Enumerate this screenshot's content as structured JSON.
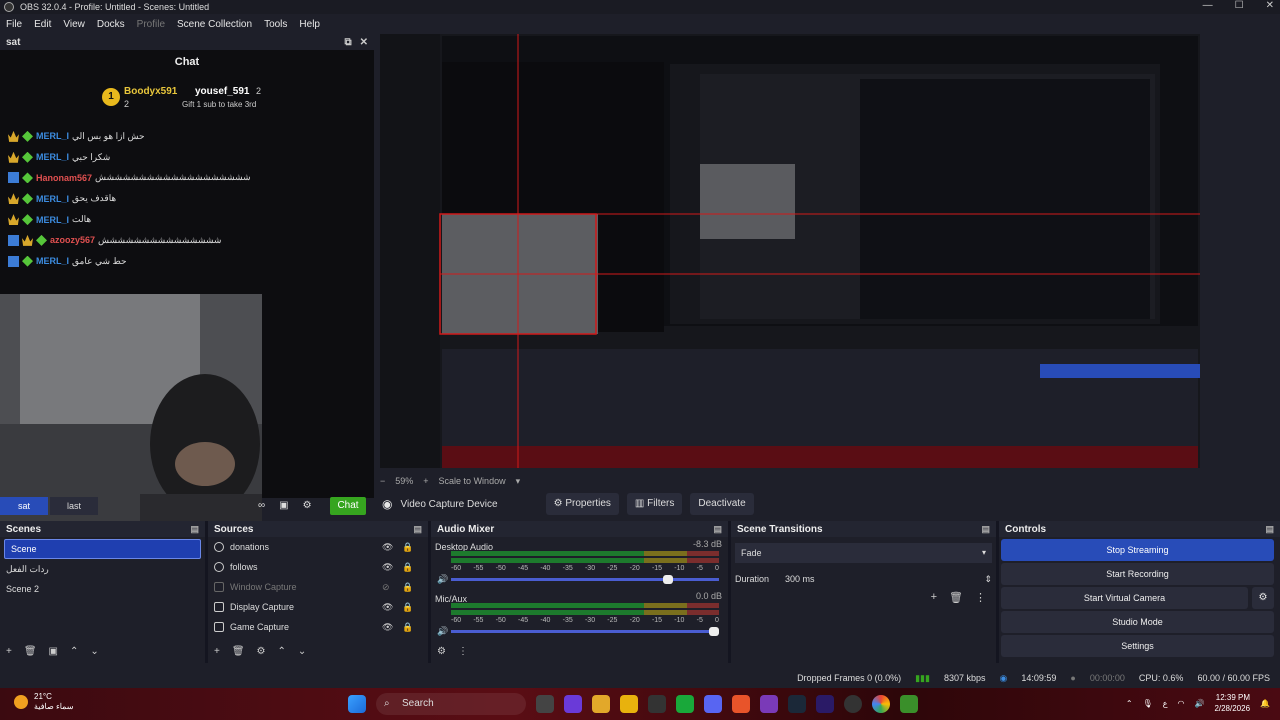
{
  "window": {
    "title": "OBS 32.0.4 - Profile: Untitled - Scenes: Untitled"
  },
  "menu": [
    "File",
    "Edit",
    "View",
    "Docks",
    "Profile",
    "Scene Collection",
    "Tools",
    "Help"
  ],
  "chat_dock": {
    "title": "sat",
    "heading": "Chat",
    "gift": {
      "user1": "Boodyx591",
      "count1": "2",
      "user2": "yousef_591",
      "count2": "2",
      "message": "Gift 1 sub to take 3rd"
    },
    "messages": [
      {
        "user": "MERL_I",
        "text": "حش ازا هو بس الي"
      },
      {
        "user": "MERL_I",
        "text": "شكرا حبي"
      },
      {
        "user": "Hanonam567",
        "text": "ششششششششششششششششششش"
      },
      {
        "user": "MERL_I",
        "text": "هاقدف يحق"
      },
      {
        "user": "MERL_I",
        "text": "هالت"
      },
      {
        "user": "azoozy567",
        "text": "ششششششششششششششش"
      },
      {
        "user": "MERL_I",
        "text": "حط شي عامق"
      }
    ],
    "send_label": "Chat"
  },
  "scene_tabs": [
    "sat",
    "last"
  ],
  "preview": {
    "zoom": "59%",
    "scale_mode": "Scale to Window"
  },
  "source_bar": {
    "source_name": "Video Capture Device",
    "properties": "Properties",
    "filters": "Filters",
    "deactivate": "Deactivate"
  },
  "scenes": {
    "title": "Scenes",
    "items": [
      "Scene",
      "ردات الفعل",
      "Scene 2"
    ]
  },
  "sources": {
    "title": "Sources",
    "items": [
      {
        "label": "donations",
        "icon": "globe-icon",
        "dim": false
      },
      {
        "label": "follows",
        "icon": "globe-icon",
        "dim": false
      },
      {
        "label": "Window Capture",
        "icon": "window-icon",
        "dim": true
      },
      {
        "label": "Display Capture",
        "icon": "monitor-icon",
        "dim": false
      },
      {
        "label": "Game Capture",
        "icon": "gamepad-icon",
        "dim": false
      }
    ]
  },
  "audio_mixer": {
    "title": "Audio Mixer",
    "channels": [
      {
        "name": "Desktop Audio",
        "db": "-8.3 dB",
        "level": 0.83
      },
      {
        "name": "Mic/Aux",
        "db": "0.0 dB",
        "level": 1.0
      }
    ],
    "scale": [
      "-60",
      "-55",
      "-50",
      "-45",
      "-40",
      "-35",
      "-30",
      "-25",
      "-20",
      "-15",
      "-10",
      "-5",
      "0"
    ]
  },
  "scene_transitions": {
    "title": "Scene Transitions",
    "selected": "Fade",
    "duration_label": "Duration",
    "duration_value": "300 ms"
  },
  "controls": {
    "title": "Controls",
    "buttons": [
      "Stop Streaming",
      "Start Recording",
      "Start Virtual Camera",
      "Studio Mode",
      "Settings"
    ]
  },
  "status": {
    "dropped": "Dropped Frames 0 (0.0%)",
    "bitrate": "8307 kbps",
    "stream_time": "14:09:59",
    "rec_time": "00:00:00",
    "cpu": "CPU: 0.6%",
    "fps": "60.00 / 60.00 FPS"
  },
  "taskbar": {
    "temp": "21°C",
    "weather": "سماء صافية",
    "search": "Search",
    "time": "12:39 PM",
    "date": "2/28/2026",
    "lang": "ع"
  },
  "colors": {
    "accent": "#284cb8",
    "chat_green": "#36a51f",
    "bg": "#1e1f29"
  }
}
